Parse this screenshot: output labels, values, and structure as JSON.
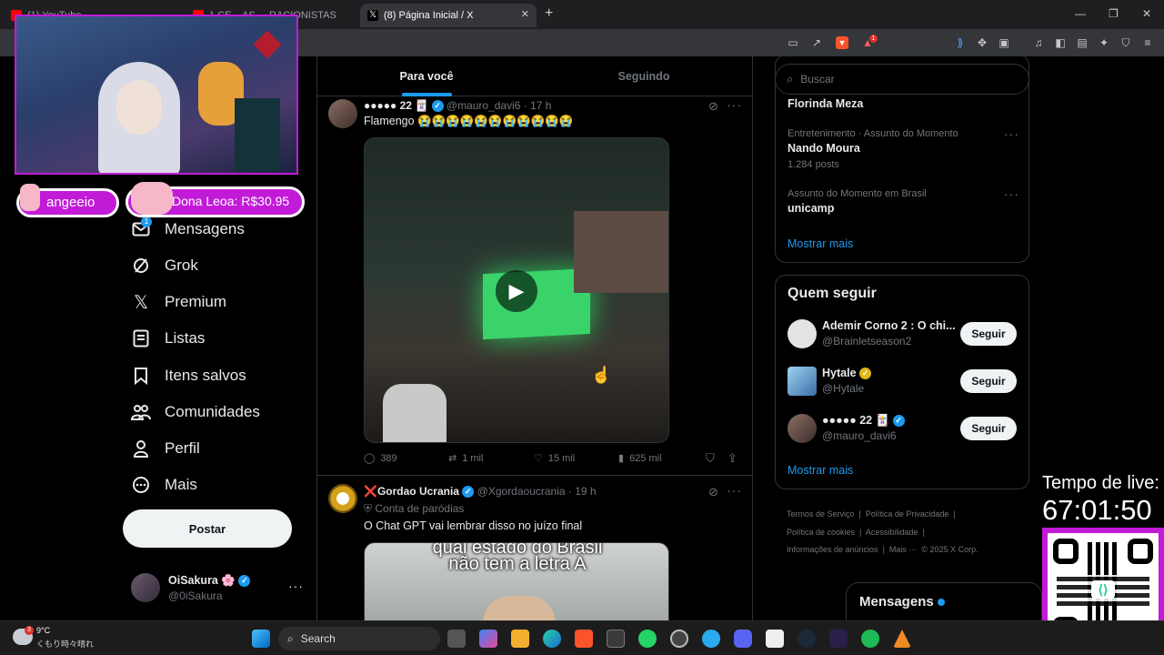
{
  "browser": {
    "tabs": [
      {
        "label": "(1) YouTube"
      },
      {
        "label": "1 CE... AS ... RACIONISTAS"
      },
      {
        "label": "(8) Página Inicial / X"
      }
    ],
    "new_tab": "+",
    "window_controls": {
      "minimize": "—",
      "maximize": "❐",
      "close": "✕"
    },
    "tab_close": "✕",
    "notification_badge": "1"
  },
  "nav": {
    "messages": {
      "label": "Mensagens",
      "badge": "1"
    },
    "grok": "Grok",
    "premium": "Premium",
    "lists": "Listas",
    "bookmarks": "Itens salvos",
    "communities": "Comunidades",
    "profile": "Perfil",
    "more": "Mais",
    "post_button": "Postar",
    "account": {
      "name": "OiSakura 🌸",
      "handle": "@0iSakura"
    }
  },
  "overlay": {
    "donation_1": "angeeio",
    "donation_2": "Dona Leoa: R$30.95",
    "live_time_label": "Tempo de live:",
    "live_time_value": "67:01:50"
  },
  "feed": {
    "tabs": {
      "for_you": "Para você",
      "following": "Seguindo"
    },
    "tweets": [
      {
        "name": "●●●●● 22 🃏",
        "handle": "@mauro_davi6",
        "time": "· 17 h",
        "text": "Flamengo 😭😭😭😭😭😭😭😭😭😭😭",
        "replies": "389",
        "retweets": "1 mil",
        "likes": "15 mil",
        "views": "625 mil"
      },
      {
        "name": "❌Gordao Ucrania",
        "handle": "@Xgordaoucrania",
        "time": "· 19 h",
        "sub": "Conta de paródias",
        "text": "O Chat GPT vai lembrar disso no juízo final",
        "media_caption_1": "qual estado do Brasil",
        "media_caption_2": "não tem a letra A"
      }
    ]
  },
  "sidebar": {
    "search_placeholder": "Buscar",
    "trends": [
      {
        "title": "Florinda Meza"
      },
      {
        "context": "Entretenimento · Assunto do Momento",
        "title": "Nando Moura",
        "count": "1.284 posts"
      },
      {
        "context": "Assunto do Momento em Brasil",
        "title": "unicamp"
      }
    ],
    "show_more_1": "Mostrar mais",
    "who_to_follow_title": "Quem seguir",
    "suggestions": [
      {
        "name": "Ademir Corno 2 : O chi...",
        "handle": "@Brainletseason2",
        "button": "Seguir"
      },
      {
        "name": "Hytale",
        "handle": "@Hytale",
        "button": "Seguir"
      },
      {
        "name": "●●●●● 22 🃏",
        "handle": "@mauro_davi6",
        "button": "Seguir"
      }
    ],
    "show_more_2": "Mostrar mais",
    "footer": {
      "terms": "Termos de Serviço",
      "privacy": "Política de Privacidade",
      "cookies": "Política de cookies",
      "accessibility": "Acessibilidade",
      "ads": "Informações de anúncios",
      "more": "Mais ···",
      "copyright": "© 2025 X Corp."
    },
    "messages_drawer": "Mensagens"
  },
  "taskbar": {
    "weather_temp": "9°C",
    "weather_desc": "くもり時々晴れ",
    "weather_badge": "3",
    "search": "Search"
  },
  "colors": {
    "accent": "#1d9bf0",
    "background": "#000000",
    "donation_border": "#c21bd8"
  }
}
